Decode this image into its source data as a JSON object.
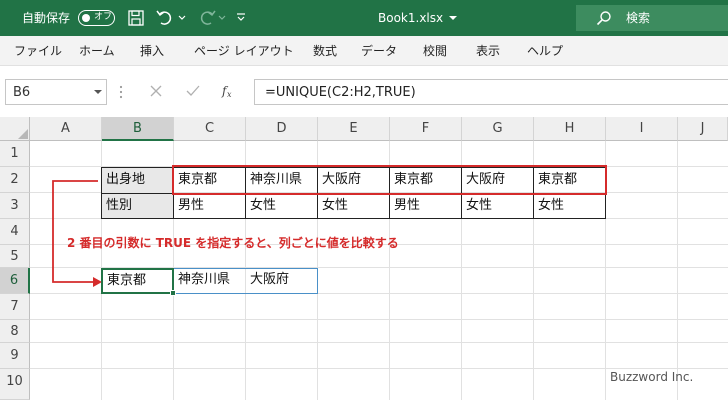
{
  "title_bar": {
    "autosave_label": "自動保存",
    "autosave_state": "オフ",
    "filename": "Book1.xlsx",
    "search_label": "検索"
  },
  "menu": [
    "ファイル",
    "ホーム",
    "挿入",
    "ページ レイアウト",
    "数式",
    "データ",
    "校閲",
    "表示",
    "ヘルプ"
  ],
  "formula_bar": {
    "name_box": "B6",
    "formula": "=UNIQUE(C2:H2,TRUE)"
  },
  "columns": [
    "A",
    "B",
    "C",
    "D",
    "E",
    "F",
    "G",
    "H",
    "I",
    "J"
  ],
  "rows": [
    "1",
    "2",
    "3",
    "4",
    "5",
    "6",
    "7",
    "8",
    "9",
    "10"
  ],
  "selected": {
    "column": "B",
    "row": "6"
  },
  "cells": {
    "B2": "出身地",
    "C2": "東京都",
    "D2": "神奈川県",
    "E2": "大阪府",
    "F2": "東京都",
    "G2": "大阪府",
    "H2": "東京都",
    "B3": "性別",
    "C3": "男性",
    "D3": "女性",
    "E3": "女性",
    "F3": "男性",
    "G3": "女性",
    "H3": "女性",
    "B6": "東京都",
    "C6": "神奈川県",
    "D6": "大阪府"
  },
  "annotation": "2 番目の引数に TRUE を指定すると、列ごとに値を比較する",
  "watermark": "Buzzword Inc.",
  "colors": {
    "excel_green": "#217346",
    "annotation_red": "#d52b2b",
    "spill_border": "#4a90c8"
  }
}
